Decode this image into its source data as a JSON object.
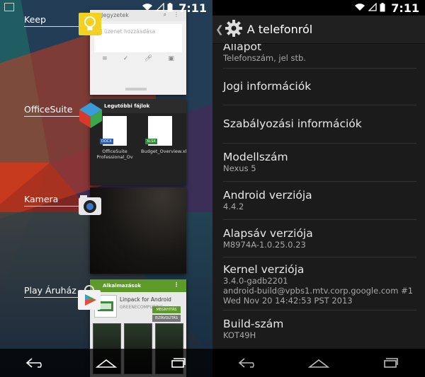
{
  "left": {
    "status_time": "7:11",
    "apps": [
      {
        "label": "Keep",
        "card": {
          "header": "Jegyzetek",
          "placeholder": "Új üzenet hozzáadása"
        }
      },
      {
        "label": "OfficeSuite",
        "card": {
          "header": "Legutóbbi fájlok",
          "files": [
            {
              "name": "OfficeSuite Professional_Ov",
              "badge": "DOCX"
            },
            {
              "name": "Budget_Overview.xlsx",
              "badge": "XLSX"
            }
          ]
        }
      },
      {
        "label": "Kamera"
      },
      {
        "label": "Play Áruház",
        "card": {
          "header": "Alkalmazások",
          "app_title": "Linpack for Android",
          "app_dev": "GREENECOMPUTING",
          "button_open": "MEGNYITÁS",
          "button_remove": "ELTÁVOLÍTÁS"
        }
      }
    ]
  },
  "right": {
    "status_time": "7:11",
    "title": "A telefonról",
    "rows": [
      {
        "title": "Állapot",
        "summary": [
          "Telefonszám, jel stb."
        ]
      },
      {
        "title": "Jogi információk",
        "summary": []
      },
      {
        "title": "Szabályozási információk",
        "summary": []
      },
      {
        "title": "Modellszám",
        "summary": [
          "Nexus 5"
        ]
      },
      {
        "title": "Android verziója",
        "summary": [
          "4.4.2"
        ]
      },
      {
        "title": "Alapsáv verziója",
        "summary": [
          "M8974A-1.0.25.0.23"
        ]
      },
      {
        "title": "Kernel verziója",
        "summary": [
          "3.4.0-gadb2201",
          "android-build@vpbs1.mtv.corp.google.com #1",
          "Wed Nov 20 14:42:53 PST 2013"
        ]
      },
      {
        "title": "Build-szám",
        "summary": [
          "KOT49H"
        ]
      }
    ]
  },
  "colors": {
    "keep_yellow": "#f4d020",
    "play_green": "#5e9a2a",
    "open_button": "#5e9a2a",
    "remove_button": "#777777"
  }
}
